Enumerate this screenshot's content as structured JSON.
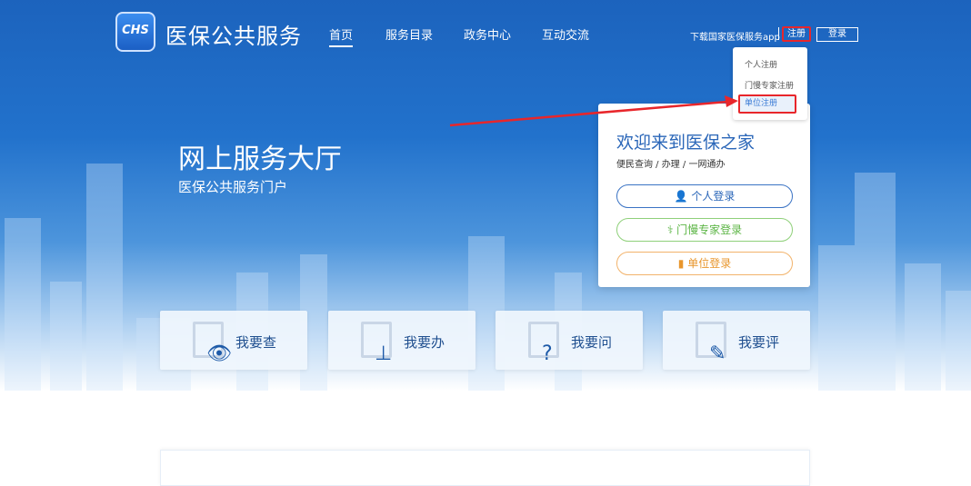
{
  "header": {
    "logo_text": "CHS",
    "brand": "医保公共服务",
    "nav": [
      "首页",
      "服务目录",
      "政务中心",
      "互动交流"
    ],
    "download": "下载国家医保服务app",
    "register": "注册",
    "login": "登录"
  },
  "register_menu": [
    "个人注册",
    "门慢专家注册",
    "单位注册"
  ],
  "hero": {
    "title": "网上服务大厅",
    "subtitle": "医保公共服务门户"
  },
  "panel": {
    "title": "欢迎来到医保之家",
    "tagline": "便民查询 / 办理 / 一网通办",
    "buttons": [
      "个人登录",
      "门慢专家登录",
      "单位登录"
    ]
  },
  "cards": [
    {
      "label": "我要查",
      "icon": "eye-icon"
    },
    {
      "label": "我要办",
      "icon": "stamp-icon"
    },
    {
      "label": "我要问",
      "icon": "question-icon"
    },
    {
      "label": "我要评",
      "icon": "pen-icon"
    }
  ]
}
